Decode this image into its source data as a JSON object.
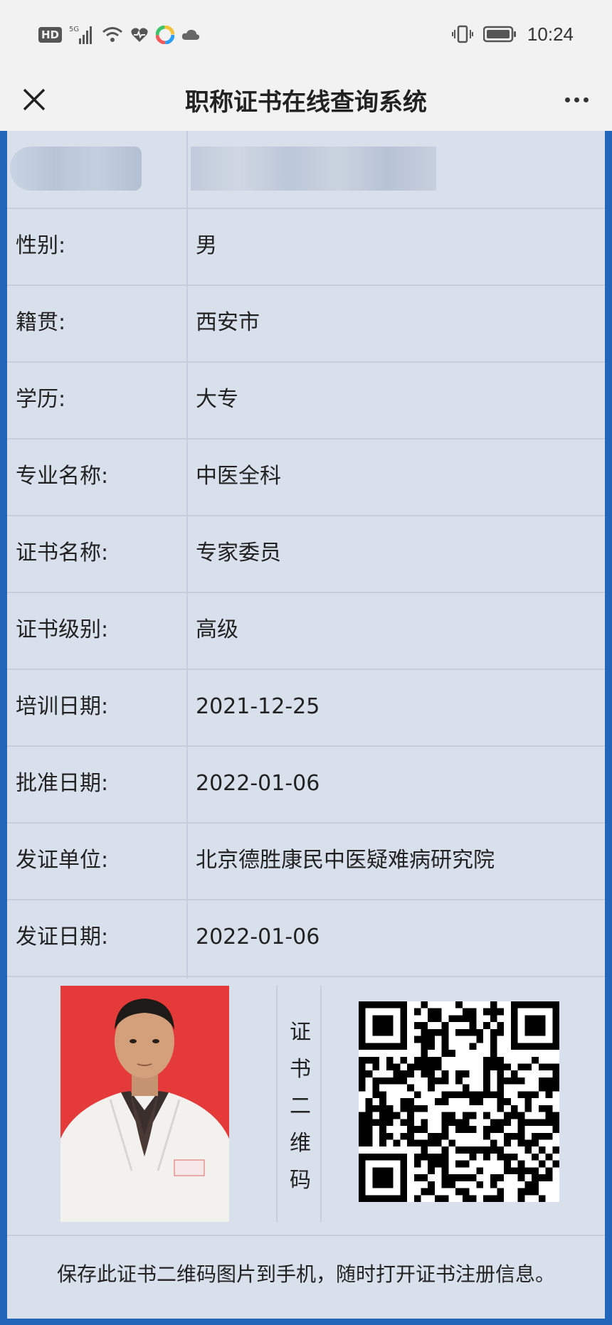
{
  "status_bar": {
    "hd_badge": "HD",
    "network": "5G",
    "time": "10:24"
  },
  "nav": {
    "title": "职称证书在线查询系统",
    "close_icon": "close-icon",
    "more_icon": "more-icon"
  },
  "fields": [
    {
      "label": "性别:",
      "value": "男"
    },
    {
      "label": "籍贯:",
      "value": "西安市"
    },
    {
      "label": "学历:",
      "value": "大专"
    },
    {
      "label": "专业名称:",
      "value": "中医全科"
    },
    {
      "label": "证书名称:",
      "value": "专家委员"
    },
    {
      "label": "证书级别:",
      "value": "高级"
    },
    {
      "label": "培训日期:",
      "value": "2021-12-25"
    },
    {
      "label": "批准日期:",
      "value": "2022-01-06"
    },
    {
      "label": "发证单位:",
      "value": "北京德胜康民中医疑难病研究院"
    },
    {
      "label": "发证日期:",
      "value": "2022-01-06"
    }
  ],
  "qr_section": {
    "label": "证书二维码"
  },
  "footer": {
    "text": "保存此证书二维码图片到手机，随时打开证书注册信息。"
  },
  "colors": {
    "frame": "#2166b8",
    "card": "#d8e0eb",
    "photo_background": "#e43a3a"
  }
}
